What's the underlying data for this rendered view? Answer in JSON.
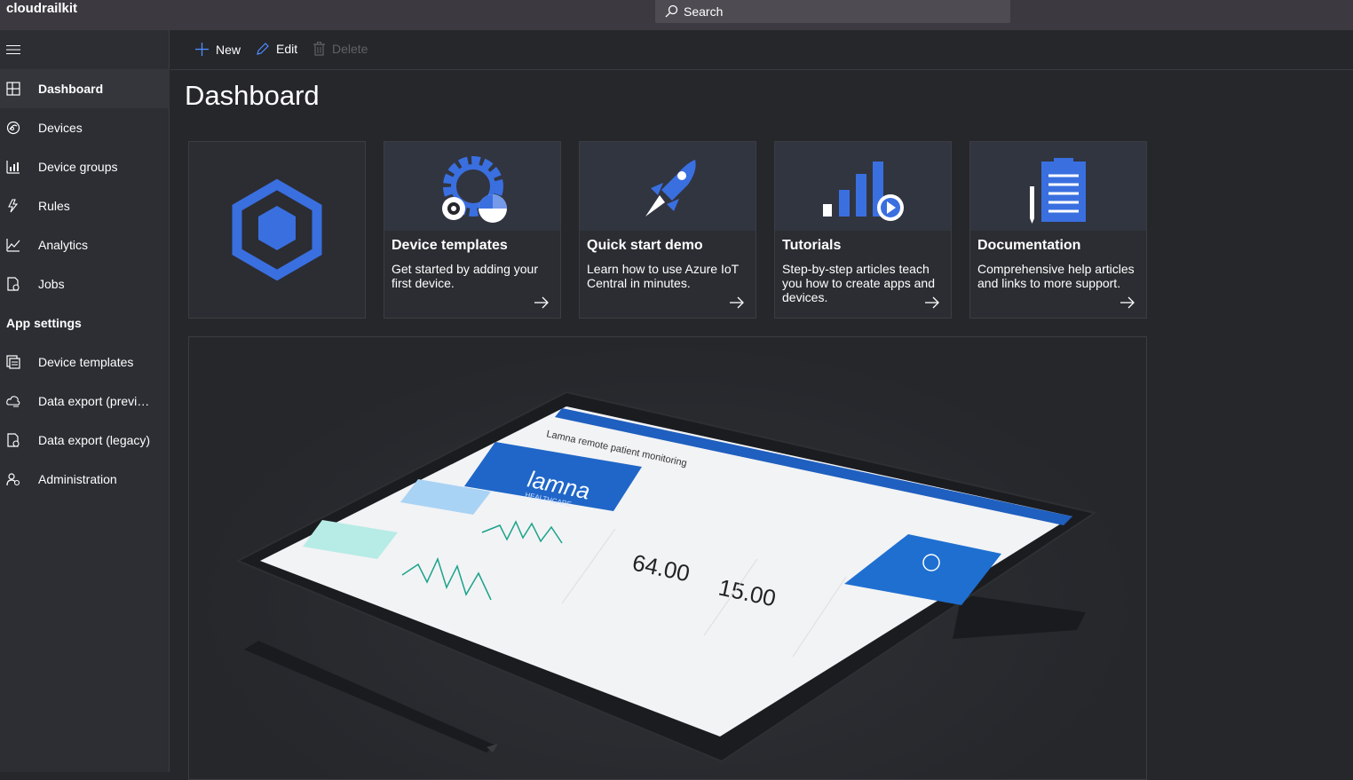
{
  "header": {
    "app_name": "cloudrailkit",
    "search_placeholder": "Search"
  },
  "sidebar": {
    "items": [
      {
        "label": "Dashboard",
        "icon": "dashboard-icon"
      },
      {
        "label": "Devices",
        "icon": "devices-icon"
      },
      {
        "label": "Device groups",
        "icon": "device-groups-icon"
      },
      {
        "label": "Rules",
        "icon": "rules-icon"
      },
      {
        "label": "Analytics",
        "icon": "analytics-icon"
      },
      {
        "label": "Jobs",
        "icon": "jobs-icon"
      }
    ],
    "section_label": "App settings",
    "settings_items": [
      {
        "label": "Device templates",
        "icon": "device-templates-icon"
      },
      {
        "label": "Data export (preview)",
        "icon": "data-export-icon"
      },
      {
        "label": "Data export (legacy)",
        "icon": "data-export-legacy-icon"
      },
      {
        "label": "Administration",
        "icon": "administration-icon"
      }
    ]
  },
  "toolbar": {
    "new_label": "New",
    "edit_label": "Edit",
    "delete_label": "Delete"
  },
  "main": {
    "title": "Dashboard",
    "tiles": [
      {
        "title": "Device templates",
        "description": "Get started by adding your first device."
      },
      {
        "title": "Quick start demo",
        "description": "Learn how to use Azure IoT Central in minutes."
      },
      {
        "title": "Tutorials",
        "description": "Step-by-step articles teach you how to create apps and devices."
      },
      {
        "title": "Documentation",
        "description": "Comprehensive help articles and links to more support."
      }
    ],
    "hero": {
      "brand": "lamna",
      "brand_sub": "HEALTHCARE",
      "screen_title": "Lamna remote patient monitoring",
      "metric_1": "64.00",
      "metric_2": "15.00"
    }
  },
  "colors": {
    "accent": "#3a6fe0",
    "topbar": "#3c3a40",
    "sidebar": "#2c2e33",
    "background": "#25272b"
  }
}
